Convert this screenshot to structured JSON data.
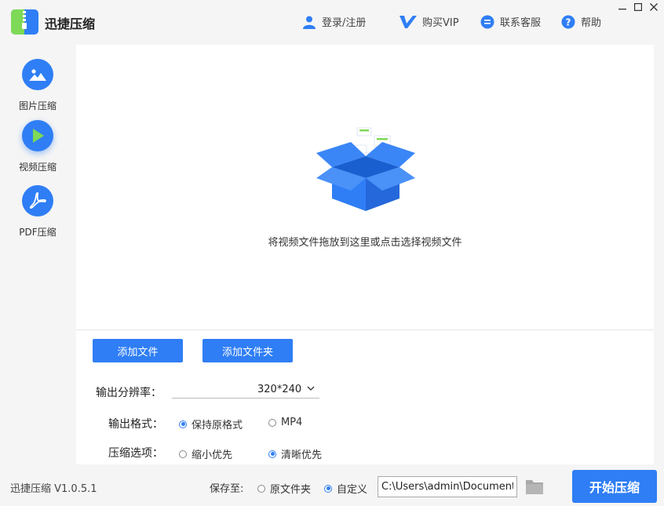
{
  "app": {
    "title": "迅捷压缩",
    "version": "迅捷压缩 V1.0.5.1"
  },
  "header": {
    "login": "登录/注册",
    "vip": "购买VIP",
    "support": "联系客服",
    "help": "帮助"
  },
  "sidebar": {
    "items": [
      {
        "label": "图片压缩",
        "icon": "image-icon",
        "active": false
      },
      {
        "label": "视频压缩",
        "icon": "play-icon",
        "active": true
      },
      {
        "label": "PDF压缩",
        "icon": "pdf-icon",
        "active": false
      }
    ]
  },
  "dropzone": {
    "hint": "将视频文件拖放到这里或点击选择视频文件"
  },
  "actions": {
    "add_file": "添加文件",
    "add_folder": "添加文件夹"
  },
  "options": {
    "resolution_label": "输出分辨率：",
    "resolution_value": "320*240",
    "format_label": "输出格式：",
    "format_options": [
      {
        "label": "保持原格式",
        "selected": true
      },
      {
        "label": "MP4",
        "selected": false
      }
    ],
    "compress_label": "压缩选项：",
    "compress_options": [
      {
        "label": "缩小优先",
        "selected": false
      },
      {
        "label": "清晰优先",
        "selected": true
      }
    ]
  },
  "footer": {
    "save_label": "保存至:",
    "save_options": [
      {
        "label": "原文件夹",
        "selected": false
      },
      {
        "label": "自定义",
        "selected": true
      }
    ],
    "path_value": "C:\\Users\\admin\\Documents",
    "start_button": "开始压缩"
  },
  "colors": {
    "accent": "#2f7ef5",
    "background": "#f5f5f5",
    "panel": "#ffffff"
  }
}
